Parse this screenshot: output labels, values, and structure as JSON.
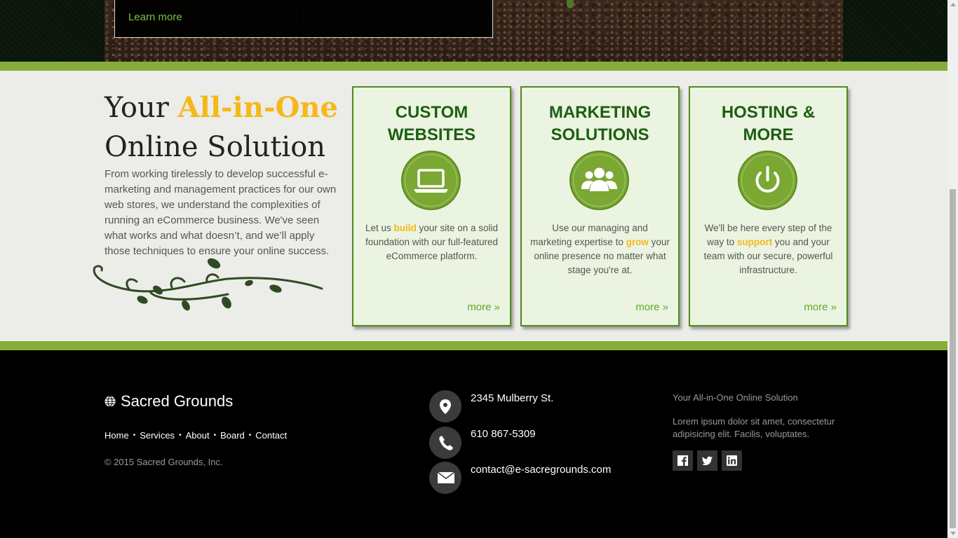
{
  "hero": {
    "learn_more": "Learn more"
  },
  "headline": {
    "prefix": "Your ",
    "accent": "All-in-One",
    "suffix": "Online Solution"
  },
  "intro": "From working tirelessly to develop successful e-marketing and management practices for our own web stores, we understand the complexities of running an eCommerce business. We've seen what works and what doesn’t, and we’ll apply those techniques to ensure your online success.",
  "cards": [
    {
      "title_line1": "CUSTOM",
      "title_line2": "WEBSITES",
      "icon": "laptop-icon",
      "desc_before": "Let us ",
      "desc_highlight": "build",
      "desc_after": " your site on a solid foundation with our full-featured eCommerce platform.",
      "more": "more »"
    },
    {
      "title_line1": "MARKETING",
      "title_line2": "SOLUTIONS",
      "icon": "users-icon",
      "desc_before": "Use our managing and marketing expertise to ",
      "desc_highlight": "grow",
      "desc_after": " your online presence no matter what stage you're at.",
      "more": "more »"
    },
    {
      "title_line1": "HOSTING &",
      "title_line2": "MORE",
      "icon": "power-icon",
      "desc_before": "We'll be here every step of the way to ",
      "desc_highlight": "support",
      "desc_after": " you and your team with our secure, powerful infrastructure.",
      "more": "more »"
    }
  ],
  "footer": {
    "brand": "Sacred Grounds",
    "nav": [
      "Home",
      "Services",
      "About",
      "Board",
      "Contact"
    ],
    "copyright": "© 2015 Sacred Grounds, Inc.",
    "address": "2345 Mulberry St.",
    "phone": "610 867-5309",
    "email": "contact@e-sacregrounds.com",
    "tagline": "Your All-in-One Online Solution",
    "lorem": "Lorem ipsum dolor sit amet, consectetur adipisicing elit. Facilis, voluptates.",
    "social": [
      "facebook-icon",
      "twitter-icon",
      "linkedin-icon"
    ]
  },
  "colors": {
    "accent": "#f4b81a",
    "green_bar": "#86ad3c",
    "card_title": "#1d5e12",
    "link_green": "#5cab24"
  }
}
